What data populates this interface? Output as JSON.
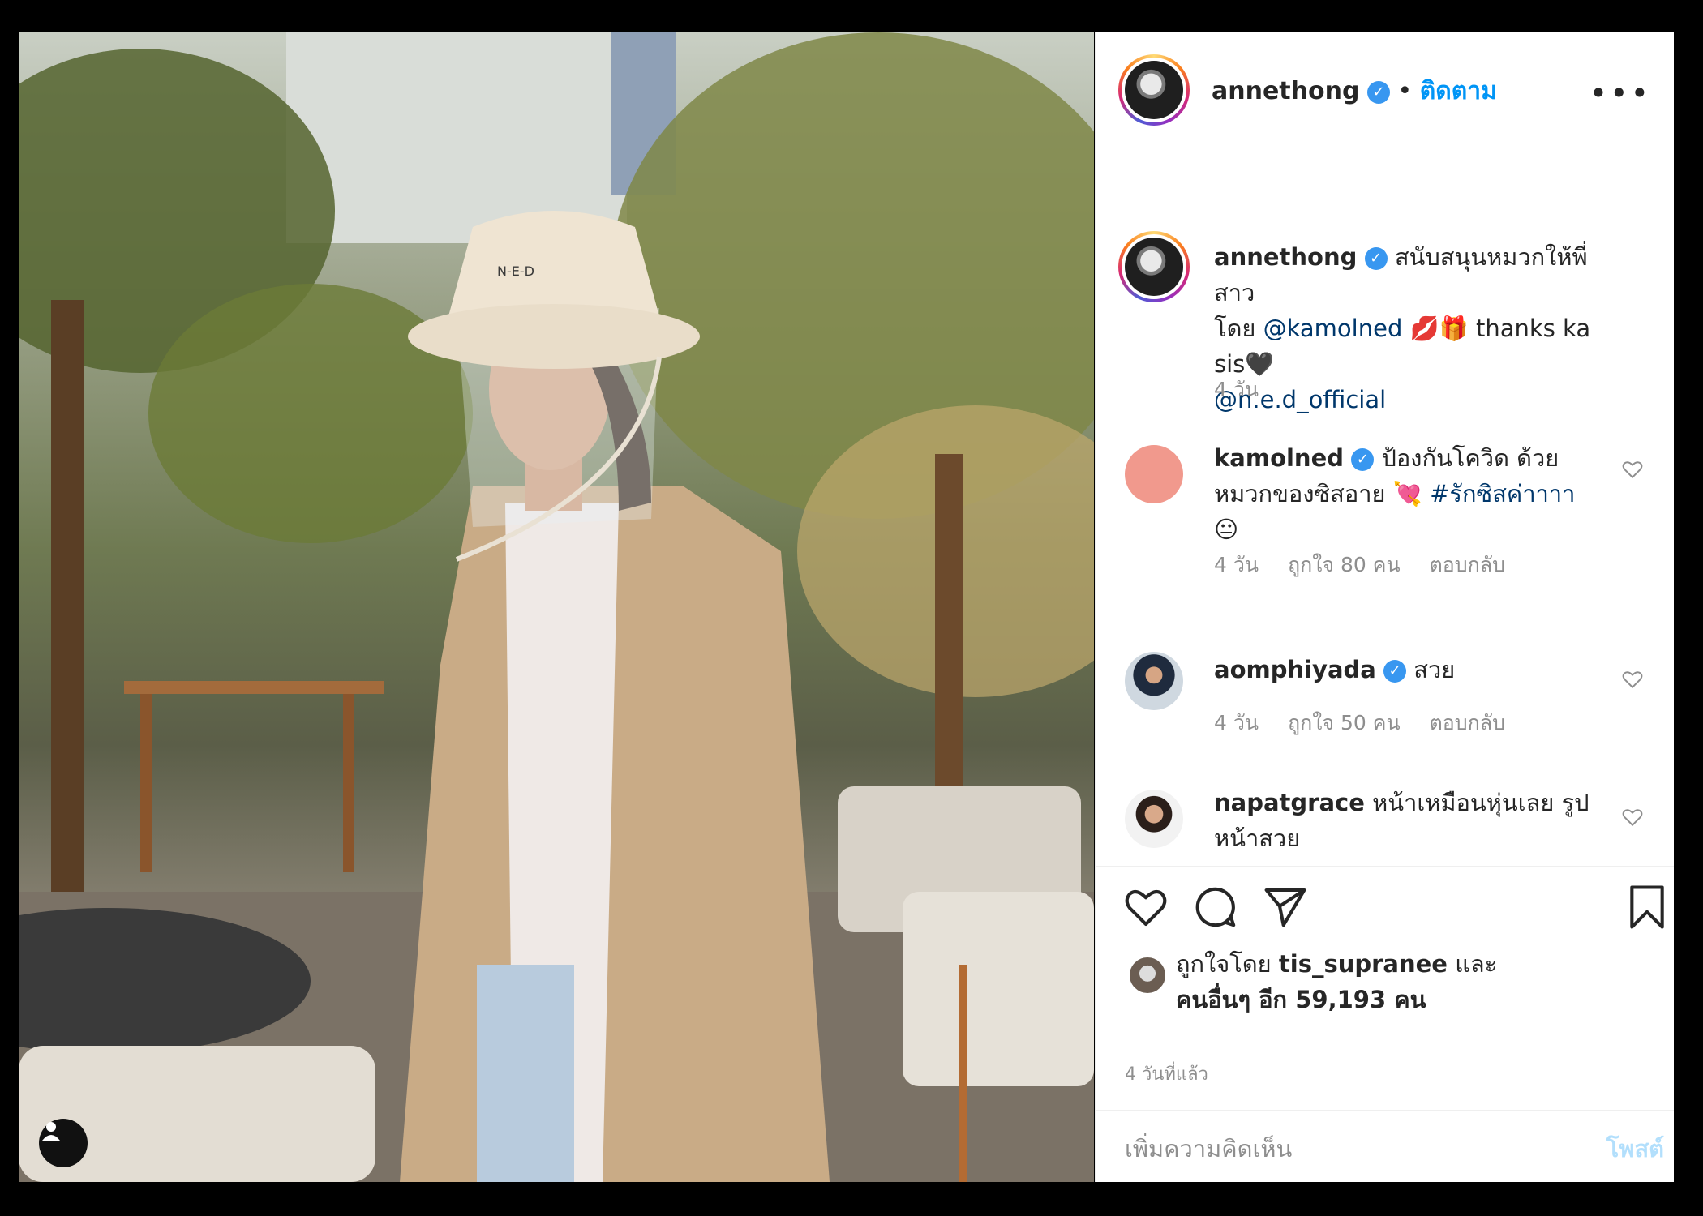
{
  "post": {
    "author": "annethong",
    "follow_label": "ติดตาม",
    "more_label": "•••",
    "separator": "•"
  },
  "caption": {
    "user": "annethong",
    "line1": "สนับสนุนหมวกให้พี่สาว",
    "line2_pre": "โดย ",
    "mention1": "@kamolned",
    "line2_post": " 💋🎁 thanks ka sis🖤",
    "mention2": "@n.e.d_official",
    "time": "4 วัน"
  },
  "comments": [
    {
      "user": "kamolned",
      "verified": true,
      "text_a": "ป้องกันโควิด ด้วย",
      "text_b": "หมวกของซิสอาย 💘 ",
      "hashtag": "#รักซิสค่าาาา",
      "text_c": "😐",
      "time": "4 วัน",
      "likes": "ถูกใจ 80 คน",
      "reply": "ตอบกลับ",
      "avatar_color": "#f1998d"
    },
    {
      "user": "aomphiyada",
      "verified": true,
      "text_a": "สวย",
      "time": "4 วัน",
      "likes": "ถูกใจ 50 คน",
      "reply": "ตอบกลับ"
    },
    {
      "user": "napatgrace",
      "verified": false,
      "text_a": "หน้าเหมือนหุ่นเลย รูป",
      "text_b": "หน้าสวย"
    }
  ],
  "likes": {
    "prefix": "ถูกใจโดย ",
    "liker": "tis_supranee",
    "mid": " และ",
    "line2": "คนอื่นๆ อีก 59,193 คน"
  },
  "date": "4 วันที่แล้ว",
  "add_comment": {
    "placeholder": "เพิ่มความคิดเห็น",
    "post_label": "โพสต์"
  },
  "colors": {
    "verified": "#3897f0",
    "follow": "#0095f6",
    "mention": "#00376b",
    "post_disabled": "#b2dffc"
  },
  "icons": [
    "verified-badge-icon",
    "more-options-icon",
    "heart-icon",
    "comment-icon",
    "share-icon",
    "bookmark-icon",
    "user-tag-icon"
  ]
}
